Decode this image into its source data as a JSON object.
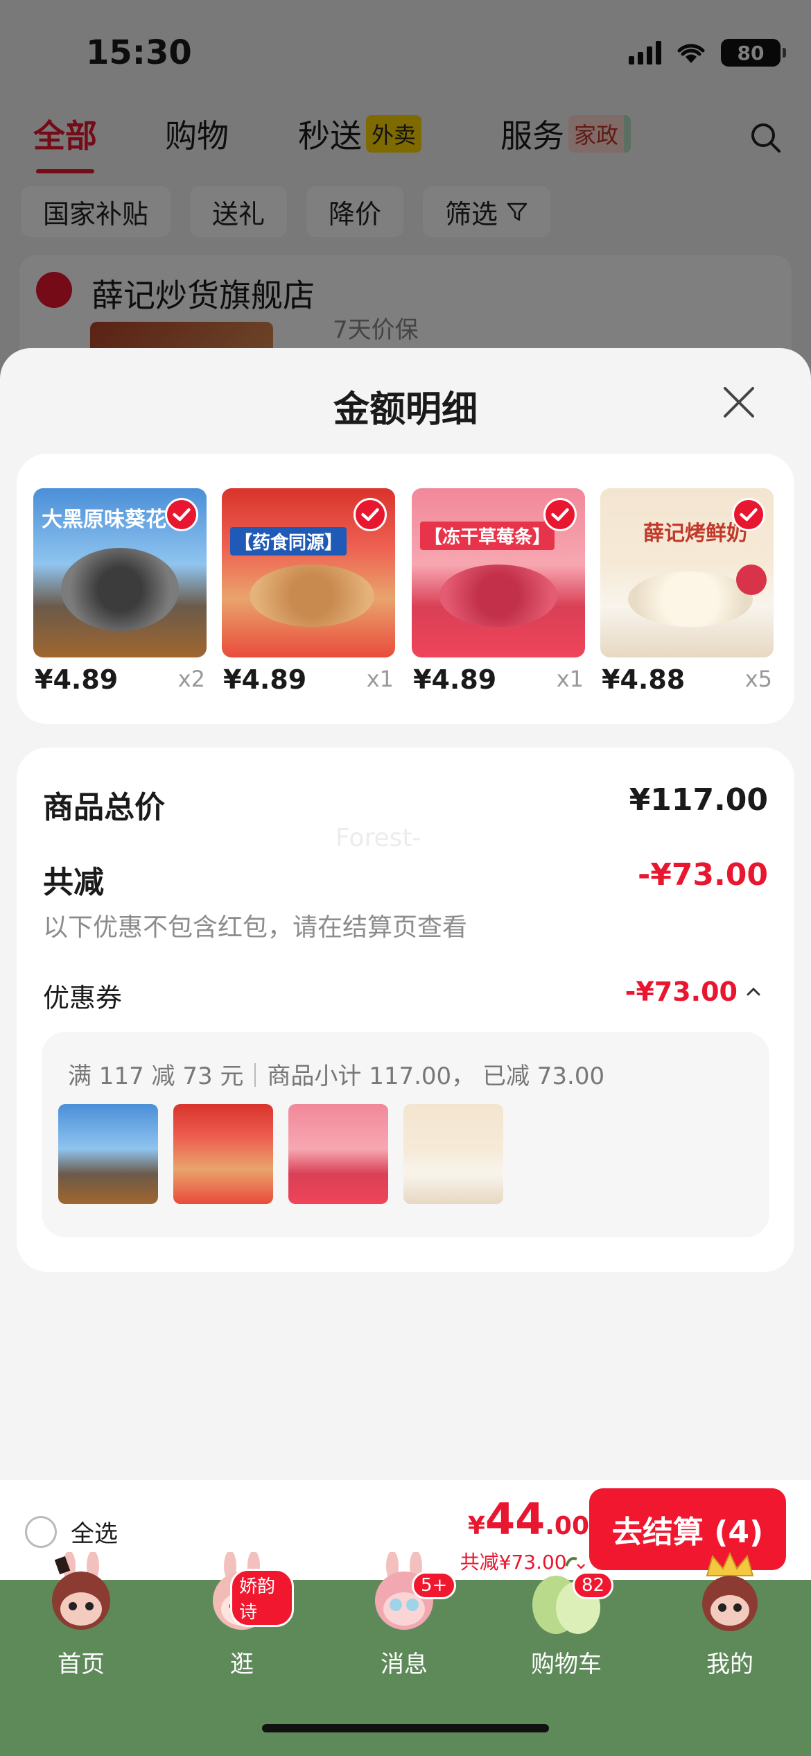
{
  "status_bar": {
    "time": "15:30",
    "battery": "80"
  },
  "top_tabs": [
    {
      "label": "全部",
      "badge": ""
    },
    {
      "label": "购物",
      "badge": ""
    },
    {
      "label": "秒送",
      "badge": "外卖"
    },
    {
      "label": "服务",
      "badge": "家政"
    }
  ],
  "filters": [
    "国家补贴",
    "送礼",
    "降价",
    "筛选"
  ],
  "store": {
    "name": "薛记炒货旗舰店",
    "sub": "7天价保"
  },
  "sheet": {
    "title": "金额明细",
    "products": [
      {
        "price": "¥4.89",
        "qty": "x2",
        "label": "大黑原味葵花"
      },
      {
        "price": "¥4.89",
        "qty": "x1",
        "label": "【药食同源】"
      },
      {
        "price": "¥4.89",
        "qty": "x1",
        "label": "【冻干草莓条】"
      },
      {
        "price": "¥4.88",
        "qty": "x5",
        "label": "薛记烤鲜奶"
      }
    ],
    "goods_total_label": "商品总价",
    "goods_total_value": "¥117.00",
    "watermark": "Forest-",
    "discount_label": "共减",
    "discount_value": "-¥73.00",
    "discount_note": "以下优惠不包含红包，请在结算页查看",
    "coupon_label": "优惠券",
    "coupon_value": "-¥73.00",
    "coupon_rule": "满 117 减 73 元",
    "coupon_detail": "商品小计 117.00，  已减 73.00"
  },
  "checkout": {
    "select_all": "全选",
    "total_currency": "¥",
    "total_int": "44",
    "total_dec": ".00",
    "total_saved": "共减¥73.00",
    "pay_button": "去结算 (4)"
  },
  "nav": [
    {
      "label": "首页",
      "badge": ""
    },
    {
      "label": "逛",
      "badge": "娇韵诗"
    },
    {
      "label": "消息",
      "badge": "5+"
    },
    {
      "label": "购物车",
      "badge": "82"
    },
    {
      "label": "我的",
      "badge": ""
    }
  ],
  "colors": {
    "accent": "#e8162f",
    "nav_bg": "#5e8a5a"
  }
}
